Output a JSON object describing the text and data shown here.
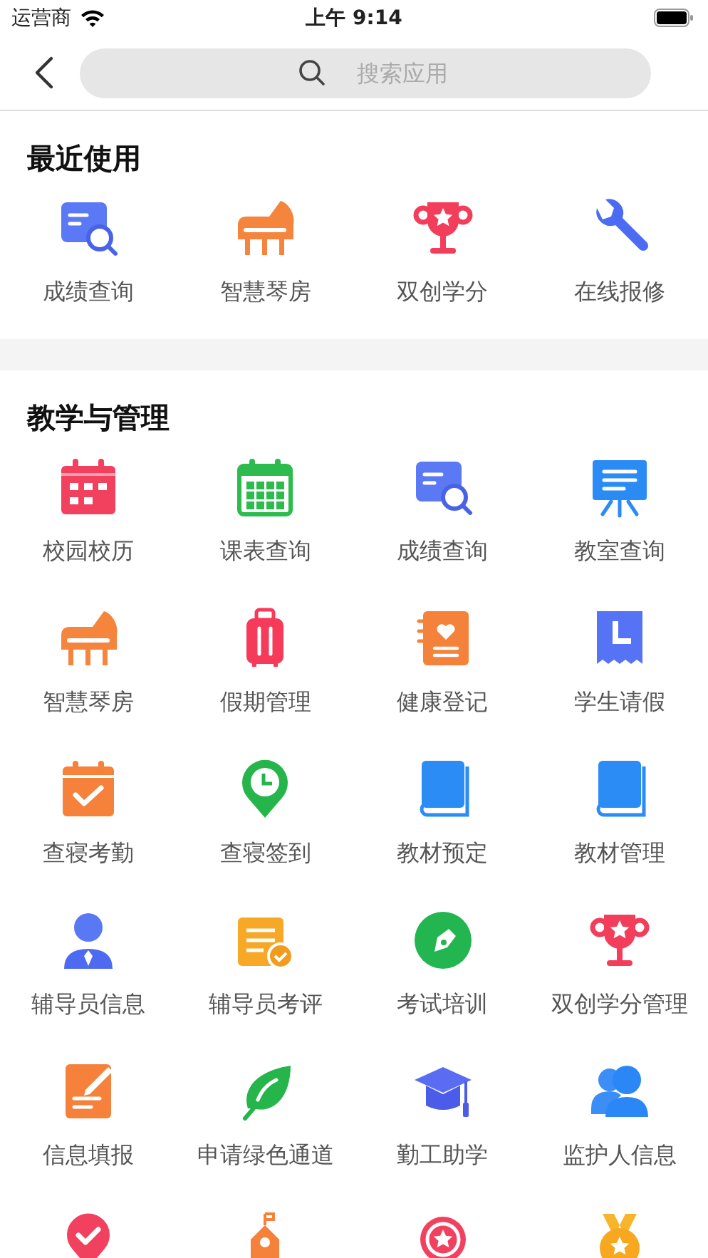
{
  "status_bar": {
    "carrier": "运营商",
    "time": "上午 9:14"
  },
  "search": {
    "placeholder": "搜索应用"
  },
  "sections": [
    {
      "title": "最近使用",
      "apps": [
        {
          "label": "成绩查询",
          "kind": "grade-search"
        },
        {
          "label": "智慧琴房",
          "kind": "piano"
        },
        {
          "label": "双创学分",
          "kind": "trophy"
        },
        {
          "label": "在线报修",
          "kind": "wrench"
        }
      ]
    },
    {
      "title": "教学与管理",
      "apps": [
        {
          "label": "校园校历",
          "kind": "calendar-red"
        },
        {
          "label": "课表查询",
          "kind": "calendar-green"
        },
        {
          "label": "成绩查询",
          "kind": "grade-search"
        },
        {
          "label": "教室查询",
          "kind": "board"
        },
        {
          "label": "智慧琴房",
          "kind": "piano"
        },
        {
          "label": "假期管理",
          "kind": "suitcase"
        },
        {
          "label": "健康登记",
          "kind": "health-book"
        },
        {
          "label": "学生请假",
          "kind": "leave-note"
        },
        {
          "label": "查寝考勤",
          "kind": "calendar-check"
        },
        {
          "label": "查寝签到",
          "kind": "location-clock"
        },
        {
          "label": "教材预定",
          "kind": "book"
        },
        {
          "label": "教材管理",
          "kind": "book"
        },
        {
          "label": "辅导员信息",
          "kind": "person"
        },
        {
          "label": "辅导员考评",
          "kind": "notepad-check"
        },
        {
          "label": "考试培训",
          "kind": "pen-circle"
        },
        {
          "label": "双创学分管理",
          "kind": "trophy"
        },
        {
          "label": "信息填报",
          "kind": "edit-doc"
        },
        {
          "label": "申请绿色通道",
          "kind": "leaf"
        },
        {
          "label": "勤工助学",
          "kind": "grad-cap"
        },
        {
          "label": "监护人信息",
          "kind": "people"
        },
        {
          "kind": "location-check"
        },
        {
          "kind": "school"
        },
        {
          "kind": "badge"
        },
        {
          "kind": "medal"
        }
      ]
    }
  ]
}
